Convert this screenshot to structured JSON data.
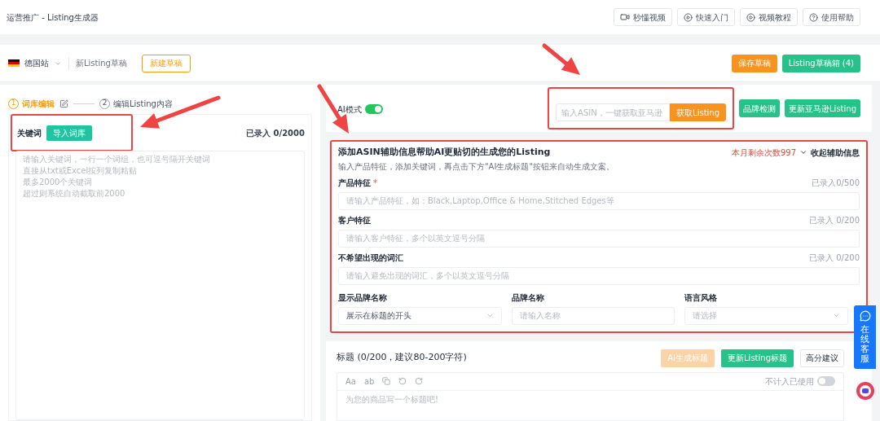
{
  "header": {
    "title": "运营推广 - Listing生成器",
    "buttons": [
      {
        "label": "秒懂视频",
        "kind": "video"
      },
      {
        "label": "快速入门",
        "kind": "play"
      },
      {
        "label": "视频教程",
        "kind": "play"
      },
      {
        "label": "使用帮助",
        "kind": "help"
      }
    ]
  },
  "toolbar": {
    "site": "德国站",
    "draft_name": "新Listing草稿",
    "new_draft": "新建草稿",
    "save": "保存草稿",
    "drafts": "Listing草稿箱 (4)"
  },
  "steps": [
    {
      "number": "1",
      "label": "词库编辑",
      "selected": true
    },
    {
      "number": "2",
      "label": "编辑Listing内容",
      "selected": false
    }
  ],
  "keywords": {
    "label": "关键词",
    "import": "导入词库",
    "count": "已录入 0/2000",
    "placeholder_lines": [
      "请输入关键词，一行一个词组，也可逗号隔开关键词",
      "直接从txt或Excel按列复制粘贴",
      "最多2000个关键词",
      "超过则系统自动截取前2000"
    ],
    "highlighted": true
  },
  "ai_mode": {
    "label": "AI模式",
    "on": true
  },
  "asin": {
    "placeholder": "输入ASIN，一键获取亚马逊",
    "fetch": "获取Listing",
    "highlighted": true
  },
  "actions": [
    "品牌检测",
    "更新亚马逊Listing"
  ],
  "assist": {
    "highlighted": true,
    "title": "添加ASIN辅助信息帮助AI更贴切的生成您的Listing",
    "subtitle": "输入产品特征，添加关键词，再点击下方\"AI生成标题\"按钮来自动生成文案。",
    "remaining": "本月剩余次数997",
    "collapse": "收起辅助信息",
    "fields": [
      {
        "label": "产品特征",
        "required_mark": "*",
        "count": "已录入0/500",
        "placeholder": "请输入产品特征，如：Black,Laptop,Office & Home,Stitched Edges等"
      },
      {
        "label": "客户特征",
        "count": "已录入 0/200",
        "placeholder": "请输入客户特征，多个以英文逗号分隔"
      },
      {
        "label": "不希望出现的词汇",
        "count": "已录入 0/200",
        "placeholder": "请输入避免出现的词汇，多个以英文逗号分隔"
      }
    ],
    "options": [
      {
        "label": "显示品牌名称",
        "kind": "select",
        "value": "展示在标题的开头"
      },
      {
        "label": "品牌名称",
        "kind": "input",
        "placeholder": "请输入名称"
      },
      {
        "label": "语言风格",
        "kind": "select",
        "placeholder": "请选择"
      }
    ]
  },
  "title_card": {
    "heading": "标题 (0/200，建议80-200字符)",
    "ai_button": {
      "label": "AI生成标题",
      "disabled": true
    },
    "update": "更新Listing标题",
    "tips": "高分建议",
    "tools": [
      "Aa",
      "ab"
    ],
    "exclude": {
      "label": "不计入已使用",
      "on": false
    },
    "placeholder": "为您的商品写一个标题吧!"
  },
  "support": {
    "label": "在线客服"
  }
}
